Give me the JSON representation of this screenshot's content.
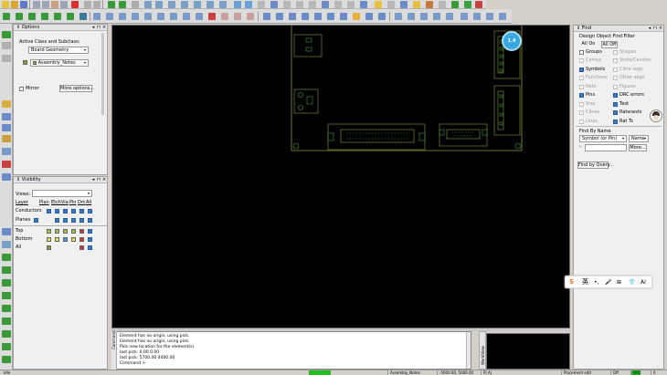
{
  "options_panel": {
    "title": "Options",
    "active_class_label": "Active Class and Subclass:",
    "class_value": "Board Geometry",
    "subclass_value": "Assembly_Notes",
    "mirror_label": "Mirror",
    "more_options_label": "More options..."
  },
  "visibility_panel": {
    "title": "Visibility",
    "views_label": "Views:",
    "layer_label": "Layer",
    "columns": [
      "Plan",
      "Etch",
      "Via",
      "Pin",
      "Drc",
      "All"
    ],
    "rows": [
      "Conductors",
      "Planes"
    ],
    "layers": [
      "Top",
      "Bottom",
      "All"
    ]
  },
  "find_panel": {
    "title": "Find",
    "filter_title": "Design Object Find Filter",
    "all_on": "All On",
    "all_off": "All Off",
    "items_left": [
      {
        "label": "Groups",
        "state": "off"
      },
      {
        "label": "Comps",
        "state": "disabled"
      },
      {
        "label": "Symbols",
        "state": "on"
      },
      {
        "label": "Functions",
        "state": "disabled"
      },
      {
        "label": "Nets",
        "state": "disabled"
      },
      {
        "label": "Pins",
        "state": "on"
      },
      {
        "label": "Vias",
        "state": "disabled"
      },
      {
        "label": "Clines",
        "state": "disabled"
      },
      {
        "label": "Lines",
        "state": "disabled"
      }
    ],
    "items_right": [
      {
        "label": "Shapes",
        "state": "disabled"
      },
      {
        "label": "Voids/Cavities",
        "state": "disabled"
      },
      {
        "label": "Cline segs",
        "state": "disabled"
      },
      {
        "label": "Other segs",
        "state": "disabled"
      },
      {
        "label": "Figures",
        "state": "disabled"
      },
      {
        "label": "DRC errors",
        "state": "on"
      },
      {
        "label": "Text",
        "state": "on"
      },
      {
        "label": "Ratsnests",
        "state": "on"
      },
      {
        "label": "Rat Ts",
        "state": "on"
      }
    ],
    "find_by_name_label": "Find By Name",
    "name_type": "Symbol (or Pin)",
    "name_mode": "Name",
    "more_label": "More...",
    "find_by_query_label": "Find by Query..."
  },
  "command_window": {
    "lines": [
      "Element has no origin, using pick.",
      "Element has no origin, using pick.",
      "Pick new location for the element(s)",
      "last pick:  0.00 0.00",
      "last pick:  5700.00 4400.00",
      "Command >"
    ],
    "tab_label": "Command",
    "worldview_label": "WorldView"
  },
  "status_bar": {
    "left": "Idle",
    "subclass": "Assembly_Notes",
    "coords": "-5000.00, 5000.00",
    "units": "P|  A|",
    "mode": "Placement edit",
    "off": "Off",
    "drc": "DRC",
    "count": "0"
  },
  "avatar": {
    "badge": "1.4"
  },
  "ime": {
    "labels": [
      "S",
      "英",
      "•,",
      "🎤",
      "⊞",
      "👕",
      "AI"
    ]
  },
  "colors": {
    "canvas": "#000000",
    "outline": "#8a9a3a",
    "pin": "#3aa040",
    "accent": "#3a78c8"
  }
}
